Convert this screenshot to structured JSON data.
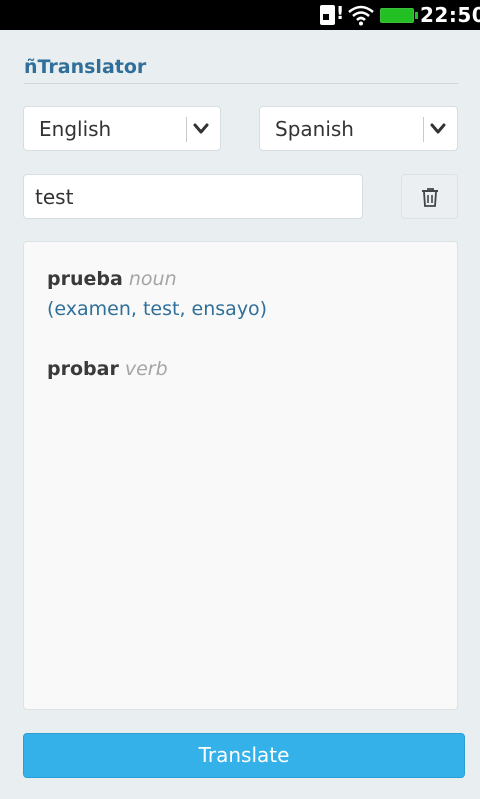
{
  "status_bar": {
    "time": "22:50",
    "alert": "!",
    "icons": [
      "sim-card-icon",
      "wifi-icon",
      "battery-icon"
    ],
    "battery_color": "#22c022"
  },
  "app": {
    "title": "ñTranslator",
    "title_color": "#2f6f99"
  },
  "languages": {
    "from": "English",
    "to": "Spanish"
  },
  "input": {
    "value": "test"
  },
  "results": {
    "entries": [
      {
        "word": "prueba",
        "pos": "noun",
        "synonyms": "(examen, test, ensayo)"
      },
      {
        "word": "probar",
        "pos": "verb"
      }
    ]
  },
  "actions": {
    "clear_icon": "trash-icon",
    "translate_label": "Translate",
    "translate_color": "#35b1ea"
  }
}
